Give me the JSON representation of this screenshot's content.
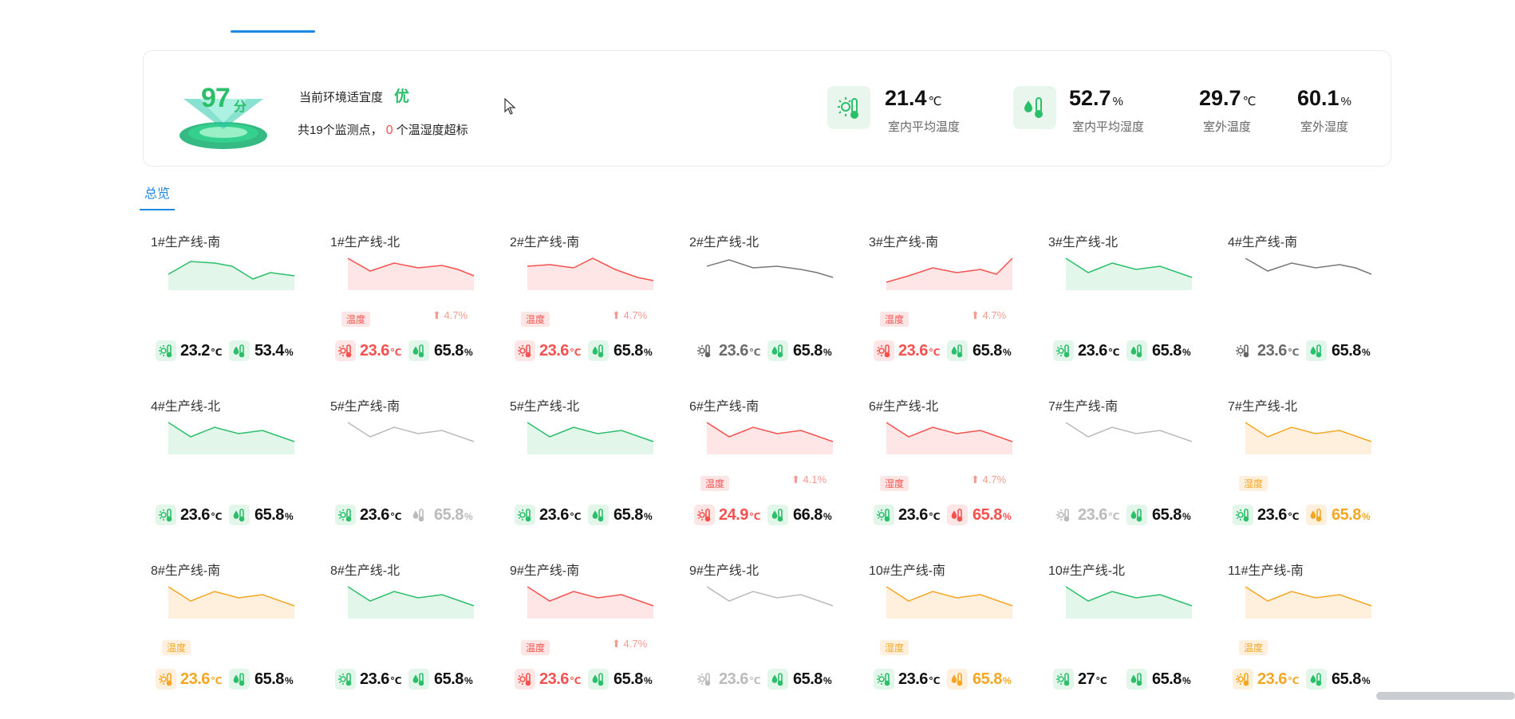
{
  "summary": {
    "score": "97",
    "score_unit": "分",
    "comfort_label": "当前环境适宜度",
    "comfort_rating": "优",
    "monitor_prefix": "共19个监测点，",
    "monitor_count": "0",
    "monitor_suffix": "个温湿度超标",
    "stats": [
      {
        "value": "21.4",
        "unit": "℃",
        "label": "室内平均温度",
        "icon": "thermometer-sun-icon"
      },
      {
        "value": "52.7",
        "unit": "%",
        "label": "室内平均湿度",
        "icon": "thermometer-droplet-icon"
      },
      {
        "value": "29.7",
        "unit": "℃",
        "label": "室外温度"
      },
      {
        "value": "60.1",
        "unit": "%",
        "label": "室外湿度"
      }
    ]
  },
  "tabs": {
    "overview": "总览"
  },
  "colors": {
    "green": "#2bbf6a",
    "red": "#f5524f",
    "orange": "#f5a623",
    "gray": "#777777",
    "lightgray": "#bbbbbb",
    "blue": "#1e88e5"
  },
  "cards": [
    {
      "title": "1#生产线-南",
      "chart": "green",
      "temp": "23.2",
      "hum": "53.4",
      "tc": "green",
      "hc": "green",
      "temp_text": "black",
      "hum_text": "black",
      "series": [
        27,
        25,
        30,
        26,
        28
      ]
    },
    {
      "title": "1#生产线-北",
      "chart": "red",
      "badge": "温度",
      "badge_color": "red",
      "trend": "⬆ 4.7%",
      "temp": "23.6",
      "hum": "65.8",
      "tc": "red",
      "hc": "green",
      "temp_text": "red",
      "hum_text": "black"
    },
    {
      "title": "2#生产线-南",
      "chart": "red",
      "badge": "温度",
      "badge_color": "red",
      "trend": "⬆ 4.7%",
      "temp": "23.6",
      "hum": "65.8",
      "tc": "red",
      "hc": "green",
      "temp_text": "red",
      "hum_text": "black"
    },
    {
      "title": "2#生产线-北",
      "chart": "gray",
      "temp": "23.6",
      "hum": "65.8",
      "tc": "gray",
      "hc": "green",
      "temp_text": "gray",
      "hum_text": "black"
    },
    {
      "title": "3#生产线-南",
      "chart": "red",
      "badge": "温度",
      "badge_color": "red",
      "trend": "⬆ 4.7%",
      "temp": "23.6",
      "hum": "65.8",
      "tc": "red",
      "hc": "green",
      "temp_text": "red",
      "hum_text": "black"
    },
    {
      "title": "3#生产线-北",
      "chart": "green",
      "temp": "23.6",
      "hum": "65.8",
      "tc": "green",
      "hc": "green",
      "temp_text": "black",
      "hum_text": "black"
    },
    {
      "title": "4#生产线-南",
      "chart": "gray",
      "temp": "23.6",
      "hum": "65.8",
      "tc": "gray",
      "hc": "green",
      "temp_text": "gray",
      "hum_text": "black"
    },
    {
      "title": "4#生产线-北",
      "chart": "green",
      "temp": "23.6",
      "hum": "65.8",
      "tc": "green",
      "hc": "green",
      "temp_text": "black",
      "hum_text": "black"
    },
    {
      "title": "5#生产线-南",
      "chart": "lightgray",
      "temp": "23.6",
      "hum": "65.8",
      "tc": "green",
      "hc": "lightgray",
      "temp_text": "black",
      "hum_text": "lightgray"
    },
    {
      "title": "5#生产线-北",
      "chart": "green",
      "temp": "23.6",
      "hum": "65.8",
      "tc": "green",
      "hc": "green",
      "temp_text": "black",
      "hum_text": "black"
    },
    {
      "title": "6#生产线-南",
      "chart": "red",
      "badge": "温度",
      "badge_color": "red",
      "trend": "⬆ 4.1%",
      "temp": "24.9",
      "hum": "66.8",
      "tc": "red",
      "hc": "green",
      "temp_text": "red",
      "hum_text": "black"
    },
    {
      "title": "6#生产线-北",
      "chart": "red",
      "badge": "湿度",
      "badge_color": "red",
      "trend": "⬆ 4.7%",
      "temp": "23.6",
      "hum": "65.8",
      "tc": "green",
      "hc": "red",
      "temp_text": "black",
      "hum_text": "red"
    },
    {
      "title": "7#生产线-南",
      "chart": "lightgray",
      "temp": "23.6",
      "hum": "65.8",
      "tc": "lightgray",
      "hc": "green",
      "temp_text": "lightgray",
      "hum_text": "black"
    },
    {
      "title": "7#生产线-北",
      "chart": "orange",
      "badge": "湿度",
      "badge_color": "orange",
      "temp": "23.6",
      "hum": "65.8",
      "tc": "green",
      "hc": "orange",
      "temp_text": "black",
      "hum_text": "orange"
    },
    {
      "title": "8#生产线-南",
      "chart": "orange",
      "badge": "温度",
      "badge_color": "orange",
      "temp": "23.6",
      "hum": "65.8",
      "tc": "orange",
      "hc": "green",
      "temp_text": "orange",
      "hum_text": "black"
    },
    {
      "title": "8#生产线-北",
      "chart": "green",
      "temp": "23.6",
      "hum": "65.8",
      "tc": "green",
      "hc": "green",
      "temp_text": "black",
      "hum_text": "black"
    },
    {
      "title": "9#生产线-南",
      "chart": "red",
      "badge": "温度",
      "badge_color": "red",
      "trend": "⬆ 4.7%",
      "temp": "23.6",
      "hum": "65.8",
      "tc": "red",
      "hc": "green",
      "temp_text": "red",
      "hum_text": "black"
    },
    {
      "title": "9#生产线-北",
      "chart": "lightgray",
      "temp": "23.6",
      "hum": "65.8",
      "tc": "lightgray",
      "hc": "green",
      "temp_text": "lightgray",
      "hum_text": "black"
    },
    {
      "title": "10#生产线-南",
      "chart": "orange",
      "badge": "湿度",
      "badge_color": "orange",
      "temp": "23.6",
      "hum": "65.8",
      "tc": "green",
      "hc": "orange",
      "temp_text": "black",
      "hum_text": "orange"
    },
    {
      "title": "10#生产线-北",
      "chart": "green",
      "temp": "27",
      "hum": "65.8",
      "tc": "green",
      "hc": "green",
      "temp_text": "black",
      "hum_text": "black"
    },
    {
      "title": "11#生产线-南",
      "chart": "orange",
      "badge": "温度",
      "badge_color": "orange",
      "temp": "23.6",
      "hum": "65.8",
      "tc": "orange",
      "hc": "green",
      "temp_text": "orange",
      "hum_text": "black"
    }
  ]
}
